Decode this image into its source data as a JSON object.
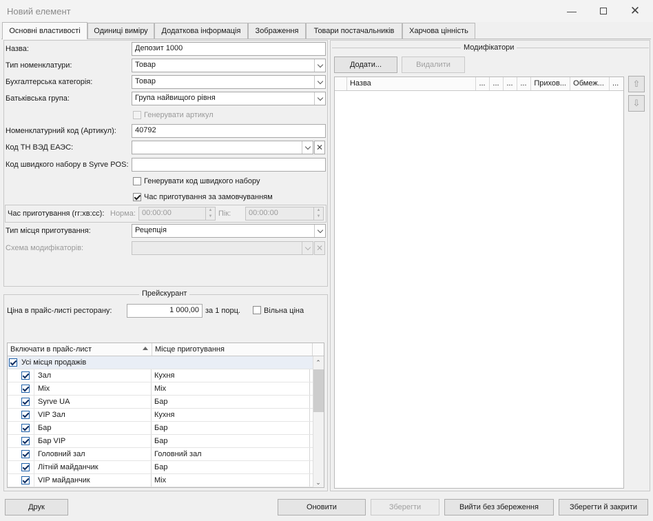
{
  "window": {
    "title": "Новий елемент"
  },
  "tabs": [
    "Основні властивості",
    "Одиниці виміру",
    "Додаткова інформація",
    "Зображення",
    "Товари постачальників",
    "Харчова цінність"
  ],
  "form": {
    "name_label": "Назва:",
    "name_value": "Депозит 1000",
    "nom_type_label": "Тип номенклатури:",
    "nom_type_value": "Товар",
    "acc_cat_label": "Бухгалтерська категорія:",
    "acc_cat_value": "Товар",
    "parent_group_label": "Батьківська група:",
    "parent_group_value": "Група найвищого рівня",
    "gen_article_label": "Генерувати артикул",
    "code_label": "Номенклатурний код (Артикул):",
    "code_value": "40792",
    "tnved_label": "Код ТН ВЭД ЕАЭС:",
    "tnved_value": "",
    "quick_code_label": "Код швидкого набору в Syrve POS:",
    "quick_code_value": "",
    "gen_quick_code_label": "Генерувати код швидкого набору",
    "default_cook_time_label": "Час приготування за замовчуванням",
    "cook_time_label": "Час приготування (гг:хв:сс):",
    "norm_label": "Норма:",
    "norm_value": "00:00:00",
    "peak_label": "Пік:",
    "peak_value": "00:00:00",
    "cook_place_type_label": "Тип місця приготування:",
    "cook_place_type_value": "Рецепція",
    "modifier_scheme_label": "Схема модифікаторів:",
    "modifier_scheme_value": ""
  },
  "price_list": {
    "legend": "Прейскурант",
    "price_label": "Ціна в прайс-листі ресторану:",
    "price_value": "1 000,00",
    "per_portion": "за 1 порц.",
    "free_price_label": "Вільна ціна",
    "col_include": "Включати в прайс-лист",
    "col_place": "Місце приготування",
    "all_label": "Усі місця продажів",
    "rows": [
      {
        "name": "Зал",
        "place": "Кухня"
      },
      {
        "name": "Mix",
        "place": "Mix"
      },
      {
        "name": "Syrve UA",
        "place": "Бар"
      },
      {
        "name": "VIP Зал",
        "place": "Кухня"
      },
      {
        "name": "Бар",
        "place": "Бар"
      },
      {
        "name": "Бар VIP",
        "place": "Бар"
      },
      {
        "name": "Головний зал",
        "place": "Головний зал"
      },
      {
        "name": "Літній майданчик",
        "place": "Бар"
      },
      {
        "name": "VIP майданчик",
        "place": "Mix"
      }
    ]
  },
  "modifiers": {
    "legend": "Модифікатори",
    "add_label": "Додати...",
    "delete_label": "Видалити",
    "columns": [
      "Назва",
      "...",
      "...",
      "...",
      "...",
      "Прихов...",
      "Обмеж...",
      "..."
    ]
  },
  "footer": {
    "print_label": "Друк",
    "refresh_label": "Оновити",
    "save_label": "Зберегти",
    "exit_label": "Вийти без збереження",
    "save_close_label": "Зберегти й закрити"
  }
}
